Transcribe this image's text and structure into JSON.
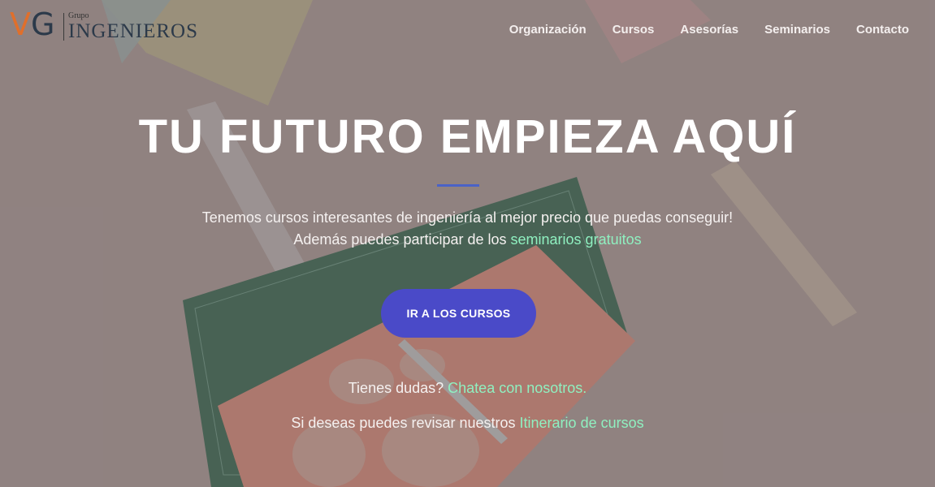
{
  "brand": {
    "logo_letters": "VG",
    "logo_top": "Grupo",
    "logo_main": "INGENIEROS"
  },
  "nav": {
    "items": [
      "Organización",
      "Cursos",
      "Asesorías",
      "Seminarios",
      "Contacto"
    ]
  },
  "hero": {
    "title": "TU FUTURO EMPIEZA AQUÍ",
    "line1": "Tenemos cursos interesantes de ingeniería al mejor precio que puedas conseguir!",
    "line2_prefix": "Además puedes participar de los ",
    "line2_link": "seminarios gratuitos",
    "cta_label": "IR A LOS CURSOS",
    "help_prefix": "Tienes dudas? ",
    "help_link": "Chatea con nosotros.",
    "itinerary_prefix": "Si deseas puedes revisar nuestros ",
    "itinerary_link": "Itinerario de cursos"
  },
  "colors": {
    "accent_link": "#8ff0c0",
    "cta_bg": "#4a4ac8",
    "logo_orange": "#e06f2b",
    "logo_dark": "#2c3a4a"
  }
}
